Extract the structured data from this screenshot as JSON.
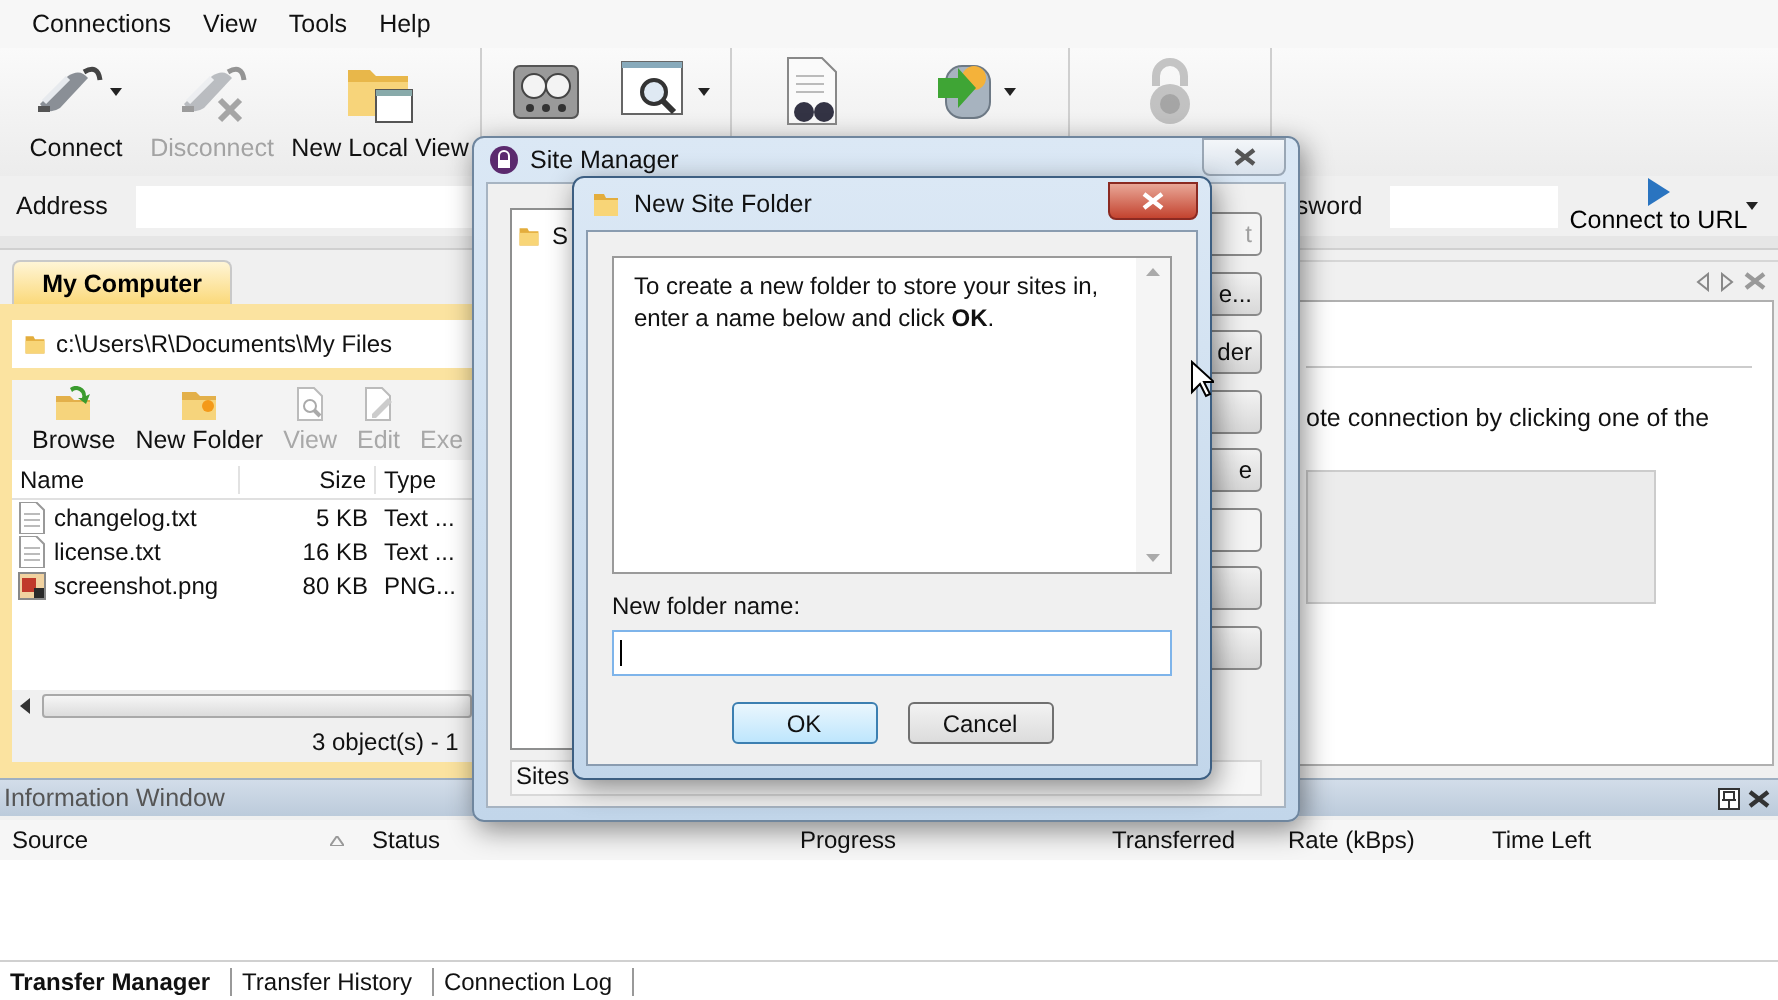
{
  "menu": [
    {
      "label": "Connections"
    },
    {
      "label": "View"
    },
    {
      "label": "Tools"
    },
    {
      "label": "Help"
    }
  ],
  "toolbar": [
    {
      "buttons": [
        {
          "label": "Connect",
          "dropdown": true,
          "disabled": false
        },
        {
          "label": "Disconnect",
          "dropdown": false,
          "disabled": true
        },
        {
          "label": "New Local View",
          "dropdown": false,
          "disabled": false
        }
      ]
    },
    {
      "buttons": [
        {
          "dropdown": false,
          "disabled": false
        },
        {
          "dropdown": true,
          "disabled": false
        }
      ]
    },
    {
      "buttons": [
        {
          "dropdown": false,
          "disabled": false
        },
        {
          "dropdown": true,
          "disabled": false
        }
      ]
    },
    {
      "buttons": [
        {
          "dropdown": false,
          "disabled": true
        }
      ]
    }
  ],
  "address_bar": {
    "label": "Address",
    "password_label": "sword",
    "connect_button": "Connect to URL"
  },
  "local_panel": {
    "tab": {
      "label": "My Computer",
      "selected": true
    },
    "path": "c:\\Users\\R\\Documents\\My Files",
    "actions": [
      {
        "label": "Browse",
        "disabled": false
      },
      {
        "label": "New Folder",
        "disabled": false
      },
      {
        "label": "View",
        "disabled": true
      },
      {
        "label": "Edit",
        "disabled": true
      },
      {
        "label": "Exe",
        "disabled": true
      }
    ],
    "columns": [
      "Name",
      "Size",
      "Type"
    ],
    "files": [
      {
        "name": "changelog.txt",
        "size": "5 KB",
        "type": "Text ...",
        "kind": "text"
      },
      {
        "name": "license.txt",
        "size": "16 KB",
        "type": "Text ...",
        "kind": "text"
      },
      {
        "name": "screenshot.png",
        "size": "80 KB",
        "type": "PNG...",
        "kind": "image"
      }
    ],
    "status": "3 object(s) - 1"
  },
  "remote_panel": {
    "message": "ote connection by clicking one of the"
  },
  "information_window": {
    "title": "Information Window",
    "columns": [
      {
        "label": "Source",
        "sorted": true
      },
      {
        "label": "Status",
        "sorted": false
      },
      {
        "label": "Progress",
        "sorted": false
      },
      {
        "label": "Transferred",
        "sorted": false
      },
      {
        "label": "Rate (kBps)",
        "sorted": false
      },
      {
        "label": "Time Left",
        "sorted": false
      }
    ]
  },
  "bottom_tabs": [
    {
      "label": "Transfer Manager",
      "selected": true
    },
    {
      "label": "Transfer History",
      "selected": false
    },
    {
      "label": "Connection Log",
      "selected": false
    }
  ],
  "site_manager": {
    "title": "Site Manager",
    "tree_items": [
      {
        "label": "S"
      }
    ],
    "buttons": [
      {
        "label": "t",
        "disabled": true
      },
      {
        "label": "e...",
        "disabled": false
      },
      {
        "label": "der",
        "disabled": false
      },
      {
        "disabled": false
      },
      {
        "label": "e",
        "disabled": false
      },
      {
        "disabled": true
      },
      {
        "disabled": false
      },
      {
        "disabled": false
      }
    ],
    "status": "Sites"
  },
  "new_site_folder": {
    "title": "New Site Folder",
    "message": "To create a new folder to store your sites in, enter a name below and click **OK**.",
    "field_label": "New folder name:",
    "buttons": [
      {
        "label": "OK",
        "default": true
      },
      {
        "label": "Cancel",
        "default": false
      }
    ]
  }
}
